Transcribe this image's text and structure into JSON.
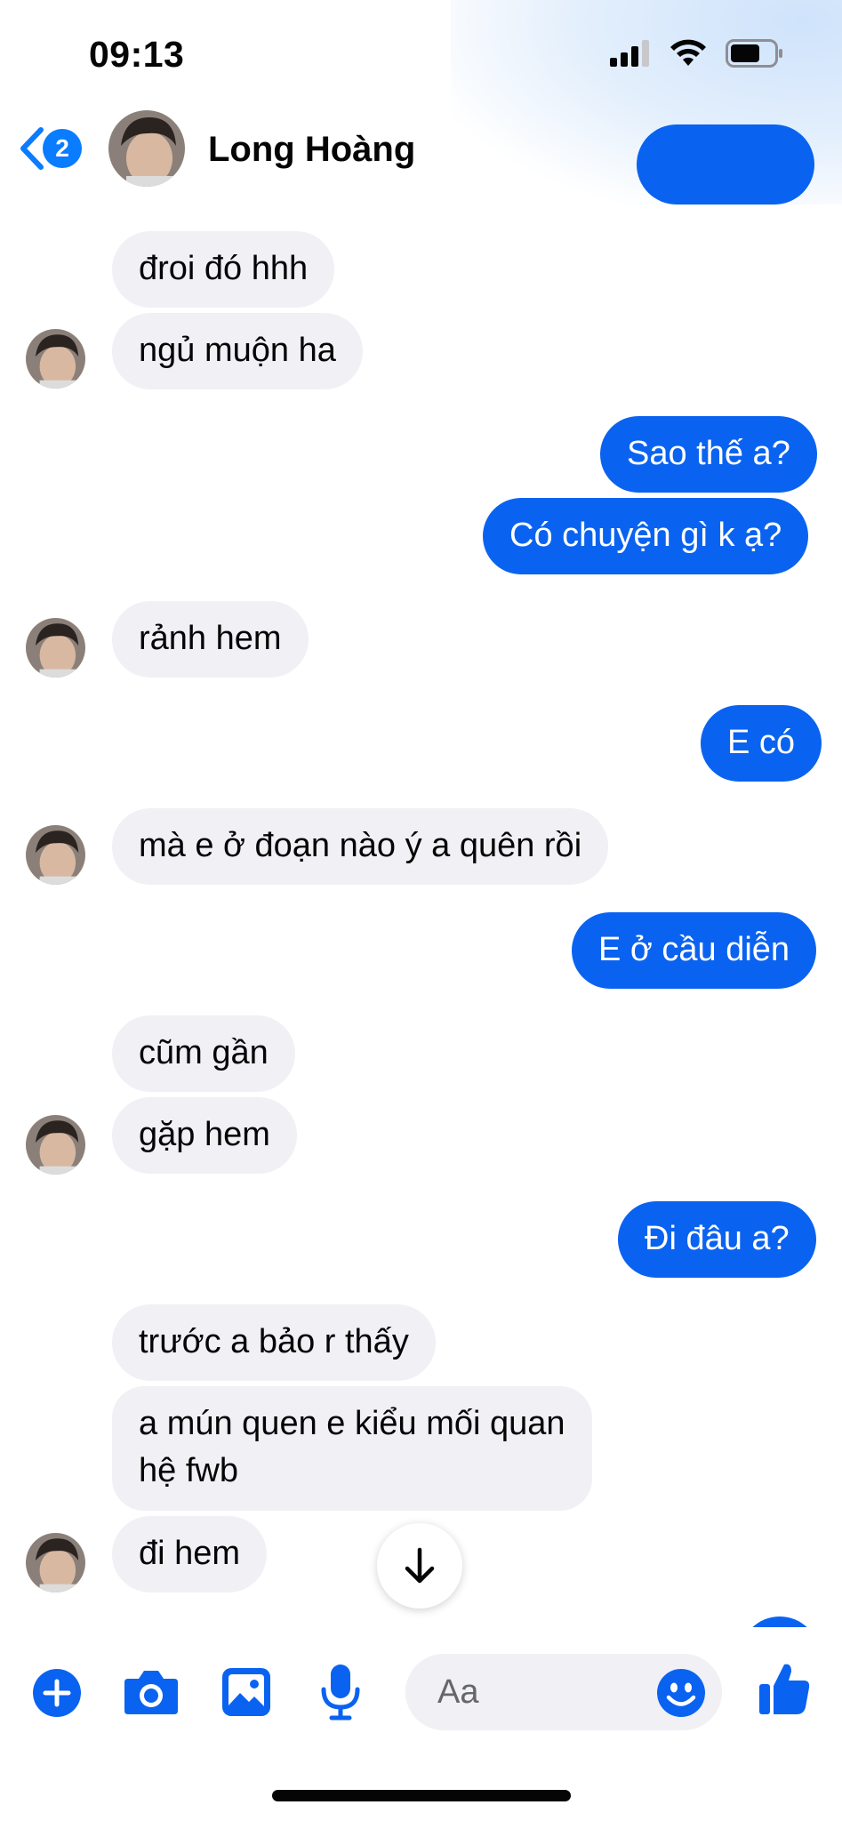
{
  "status": {
    "time": "09:13"
  },
  "header": {
    "back_badge": "2",
    "contact_name": "Long Hoàng"
  },
  "messages": {
    "m1": "đroi đó hhh",
    "m2": "ngủ muộn ha",
    "m3": "Sao thế a?",
    "m4": "Có chuyện gì k ạ?",
    "m5": "rảnh hem",
    "m6": "E có",
    "m7": "mà e ở đoạn nào ý a quên rồi",
    "m8": "E ở cầu diễn",
    "m9": "cũm gần",
    "m10": "gặp hem",
    "m11": "Đi đâu a?",
    "m12": "trước a bảo r thấy",
    "m13_line1": "a mún quen e kiểu mối quan",
    "m13_line2": "hệ fwb",
    "m14": "đi hem"
  },
  "composer": {
    "placeholder": "Aa"
  },
  "colors": {
    "outgoing": "#0a63f0",
    "incoming": "#f0f0f5",
    "accent": "#0a7cff"
  },
  "icons": [
    "back-chevron-icon",
    "phone-icon",
    "video-camera-icon",
    "plus-icon",
    "camera-icon",
    "gallery-icon",
    "microphone-icon",
    "emoji-icon",
    "thumbs-up-icon",
    "arrow-down-icon",
    "signal-icon",
    "wifi-icon",
    "battery-icon"
  ]
}
